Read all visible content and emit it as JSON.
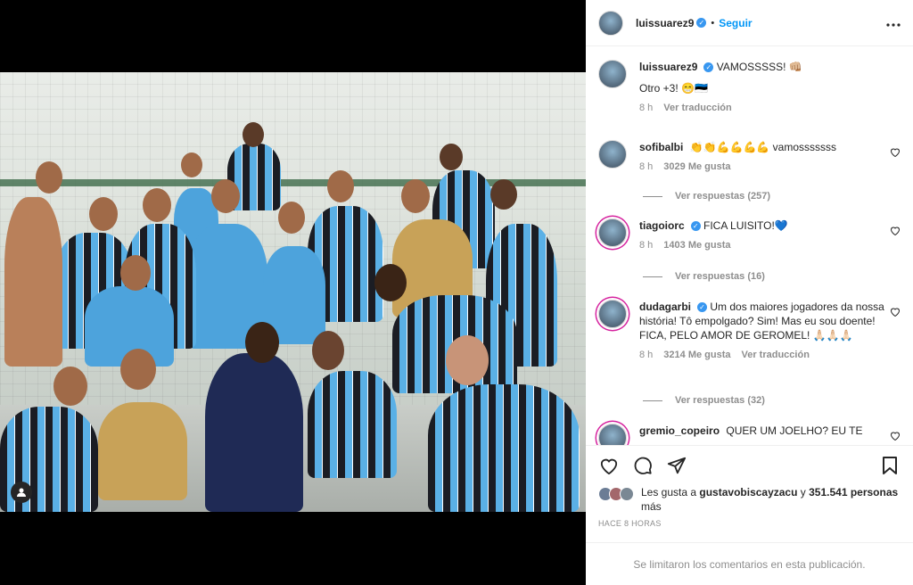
{
  "post": {
    "author": "luissuarez9",
    "verified_badge": "✓",
    "follow_label": "Seguir",
    "separator": "•",
    "more_icon": "more-horizontal-icon",
    "caption_user": "luissuarez9",
    "caption_line1": "VAMOSSSSS! 👊🏼",
    "caption_line2": "Otro +3! 😁🇪🇪",
    "caption_time": "8 h",
    "caption_translate": "Ver traducción"
  },
  "comments": [
    {
      "user": "sofibalbi",
      "verified": false,
      "text": "👏👏💪💪💪💪 vamosssssss",
      "time": "8 h",
      "likes": "3029 Me gusta",
      "translate": "",
      "replies": "Ver respuestas (257)"
    },
    {
      "user": "tiagoiorc",
      "verified": true,
      "text": "FICA LUISITO!💙",
      "time": "8 h",
      "likes": "1403 Me gusta",
      "translate": "",
      "replies": "Ver respuestas (16)"
    },
    {
      "user": "dudagarbi",
      "verified": true,
      "text": "Um dos maiores jogadores da nossa história! Tô empolgado? Sim! Mas eu sou doente! FICA, PELO AMOR DE GEROMEL! 🙏🏻🙏🏻🙏🏻",
      "time": "8 h",
      "likes": "3214 Me gusta",
      "translate": "Ver traducción",
      "replies": "Ver respuestas (32)"
    },
    {
      "user": "gremio_copeiro",
      "verified": false,
      "text": "QUER UM JOELHO? EU TE",
      "time": "",
      "likes": "",
      "translate": "",
      "replies": ""
    }
  ],
  "actions": {
    "like_icon": "heart-icon",
    "comment_icon": "comment-icon",
    "share_icon": "share-icon",
    "save_icon": "bookmark-icon"
  },
  "likes_summary": {
    "prefix": "Les gusta a ",
    "user": "gustavobiscayzacu",
    "middle": " y ",
    "count": "351.541 personas",
    "suffix": " más"
  },
  "time_ago": "HACE 8 HORAS",
  "comments_limited": "Se limitaron los comentarios en esta publicación."
}
